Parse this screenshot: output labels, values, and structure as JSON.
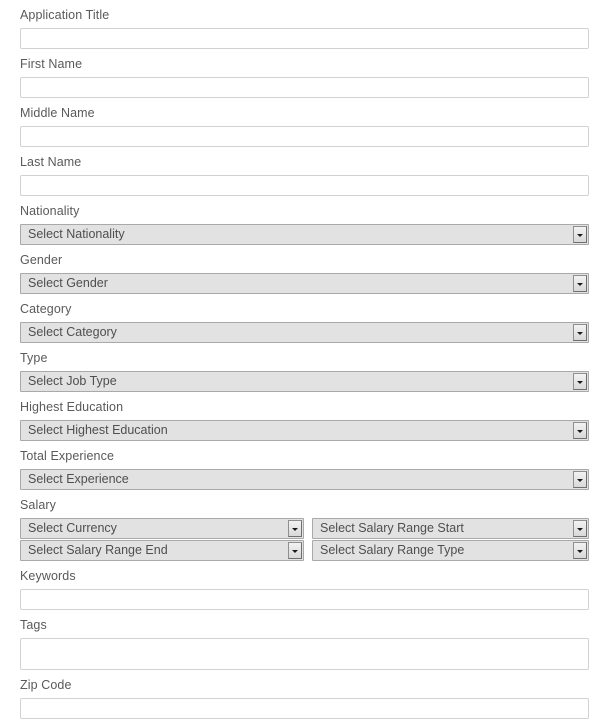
{
  "form": {
    "fields": [
      {
        "key": "application_title",
        "label": "Application Title",
        "type": "text",
        "value": "",
        "placeholder": ""
      },
      {
        "key": "first_name",
        "label": "First Name",
        "type": "text",
        "value": "",
        "placeholder": ""
      },
      {
        "key": "middle_name",
        "label": "Middle Name",
        "type": "text",
        "value": "",
        "placeholder": ""
      },
      {
        "key": "last_name",
        "label": "Last Name",
        "type": "text",
        "value": "",
        "placeholder": ""
      },
      {
        "key": "nationality",
        "label": "Nationality",
        "type": "select",
        "value": "Select Nationality"
      },
      {
        "key": "gender",
        "label": "Gender",
        "type": "select",
        "value": "Select Gender"
      },
      {
        "key": "category",
        "label": "Category",
        "type": "select",
        "value": "Select Category"
      },
      {
        "key": "type",
        "label": "Type",
        "type": "select",
        "value": "Select Job Type"
      },
      {
        "key": "highest_education",
        "label": "Highest Education",
        "type": "select",
        "value": "Select Highest Education"
      },
      {
        "key": "total_experience",
        "label": "Total Experience",
        "type": "select",
        "value": "Select Experience"
      }
    ],
    "salary": {
      "label": "Salary",
      "currency": "Select Currency",
      "range_start": "Select Salary Range Start",
      "range_end": "Select Salary Range End",
      "range_type": "Select Salary Range Type"
    },
    "keywords": {
      "label": "Keywords",
      "value": "",
      "placeholder": ""
    },
    "tags": {
      "label": "Tags",
      "value": "",
      "placeholder": ""
    },
    "zip_code": {
      "label": "Zip Code",
      "value": "",
      "placeholder": ""
    }
  },
  "colors": {
    "label_text": "#5a5a5a",
    "input_border": "#d2d2d2",
    "select_bg": "#e2e2e2",
    "select_border": "#a9a9a9",
    "select_text": "#4f4f4f",
    "page_bg": "#ffffff"
  }
}
